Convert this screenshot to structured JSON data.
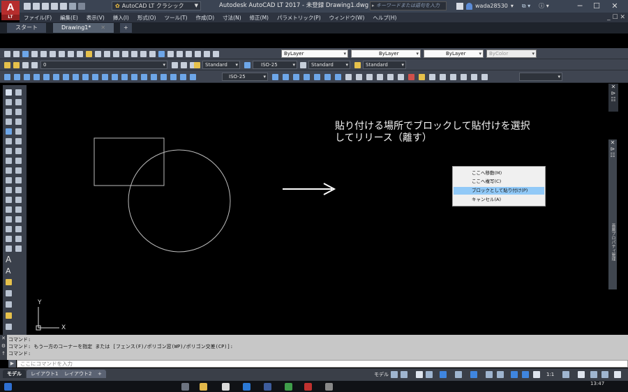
{
  "app": {
    "logo_letter": "A",
    "logo_sub": "LT",
    "workspace": "AutoCAD LT クラシック",
    "title": "Autodesk AutoCAD LT 2017 - 未登録    Drawing1.dwg",
    "search_placeholder": "キーワードまたは語句を入力",
    "user": "wada28530"
  },
  "menu": [
    "ファイル(F)",
    "編集(E)",
    "表示(V)",
    "挿入(I)",
    "形式(O)",
    "ツール(T)",
    "作成(D)",
    "寸法(N)",
    "修正(M)",
    "パラメトリック(P)",
    "ウィンドウ(W)",
    "ヘルプ(H)"
  ],
  "tabs": [
    {
      "label": "スタート"
    },
    {
      "label": "Drawing1*"
    }
  ],
  "toolbar": {
    "layer_current": "0",
    "text_style": "Standard",
    "dim_style": "ISO-25",
    "table_style": "Standard",
    "mleader_style": "Standard",
    "color": "ByLayer",
    "linetype": "ByLayer",
    "lineweight": "ByLayer",
    "plotstyle": "ByColor",
    "dim_style_2": "ISO-25"
  },
  "canvas": {
    "instruction_line1": "貼り付ける場所でブロックして貼付けを選択",
    "instruction_line2": "してリリース（離す）",
    "ucs_y": "Y",
    "ucs_x": "X"
  },
  "context_menu": {
    "items": [
      {
        "label": "ここへ移動(M)",
        "highlighted": false
      },
      {
        "label": "ここへ複写(C)",
        "highlighted": false
      },
      {
        "label": "ブロックとして貼り付け(P)",
        "highlighted": true
      },
      {
        "label": "キャンセル(A)",
        "highlighted": false
      }
    ]
  },
  "right_palette": {
    "label": "画層プロパティ管理"
  },
  "command": {
    "line1": "コマンド:",
    "line2": "コマンド: もう一方のコーナーを指定 または [フェンス(F)/ポリゴン窓(WP)/ポリゴン交差(CP)]:",
    "line3": "コマンド:",
    "input_placeholder": "ここにコマンドを入力"
  },
  "layout_tabs": [
    {
      "label": "モデル",
      "active": true
    },
    {
      "label": "レイアウト1",
      "active": false
    },
    {
      "label": "レイアウト2",
      "active": false
    },
    {
      "label": "+",
      "active": false
    }
  ],
  "status": {
    "model": "モデル",
    "scale": "1:1"
  },
  "taskbar": {
    "time": "13:47"
  },
  "colors": {
    "accent_red": "#b62d2d",
    "highlight_blue": "#91c9f7",
    "canvas": "#000000"
  }
}
